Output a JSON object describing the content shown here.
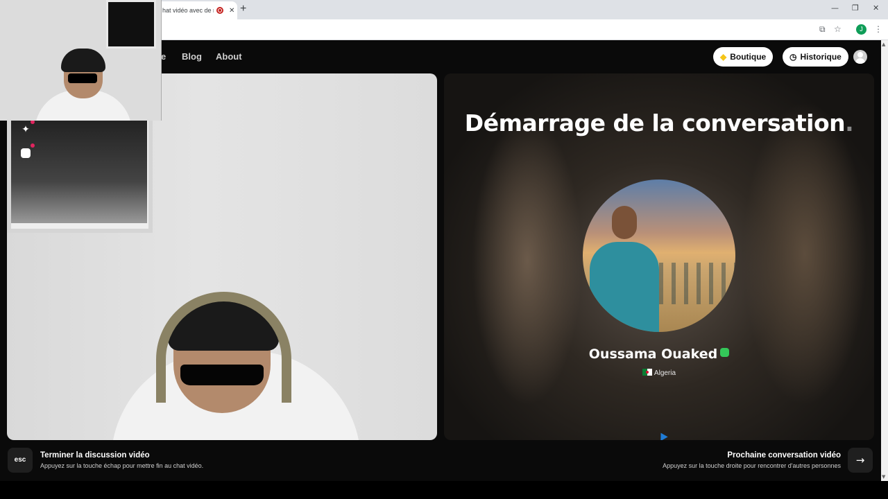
{
  "browser": {
    "tab_title": "hat vidéo avec de n",
    "tab_close": "✕",
    "new_tab": "+",
    "window_controls": [
      "—",
      "❐",
      "✕"
    ],
    "profile_initial": "J"
  },
  "nav": {
    "partial_link": "e",
    "links": [
      "Blog",
      "About"
    ],
    "boutique_label": "Boutique",
    "historique_label": "Historique"
  },
  "left_panel": {
    "side_icons": [
      "sparkles-icon",
      "smiley-icon"
    ]
  },
  "right_panel": {
    "heading": "Démarrage de la conversation",
    "heading_dot": ".",
    "user_name": "Oussama Ouaked",
    "country": "Algeria"
  },
  "footer": {
    "esc_label": "esc",
    "end_title": "Terminer la discussion vidéo",
    "end_sub": "Appuyez sur la touche échap pour mettre fin au chat vidéo.",
    "next_title": "Prochaine conversation vidéo",
    "next_sub": "Appuyez sur la touche droite pour rencontrer d'autres personnes",
    "next_arrow": "→"
  },
  "colors": {
    "background": "#0a0a0a",
    "verified": "#34c759",
    "notification_dot": "#e0245e"
  }
}
